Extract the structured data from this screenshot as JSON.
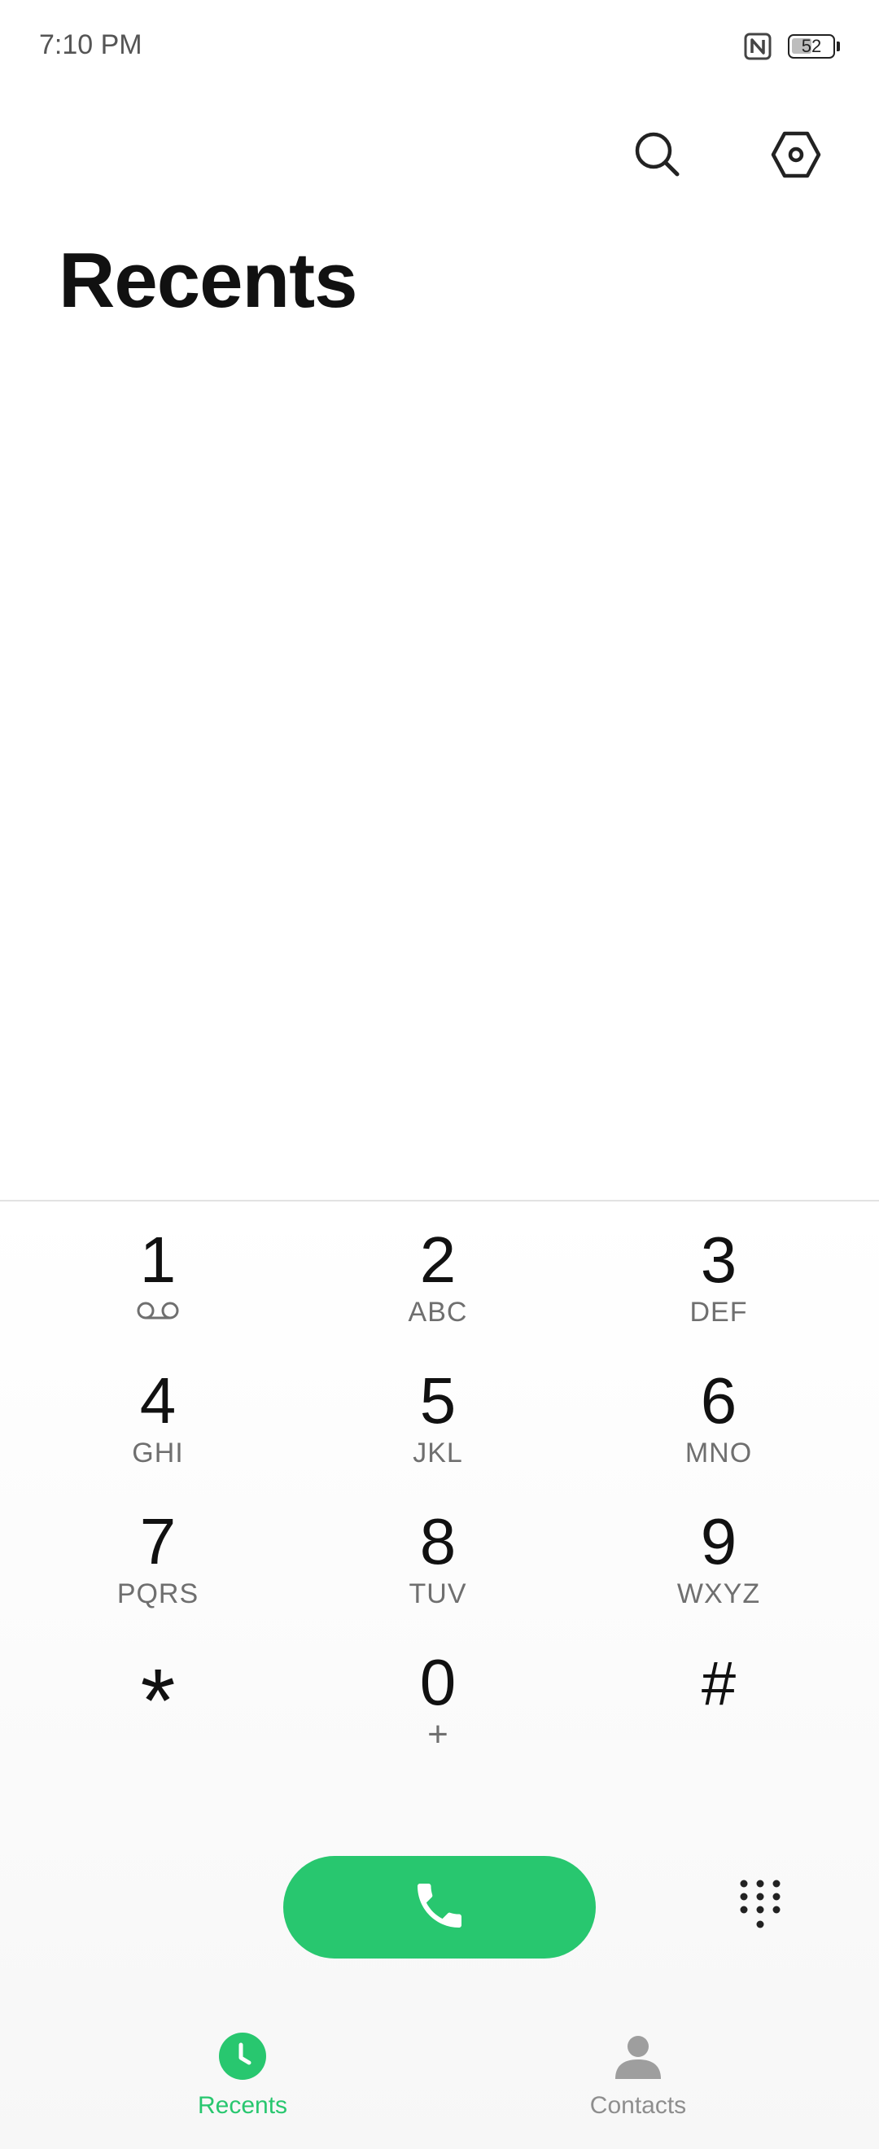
{
  "status_bar": {
    "time": "7:10 PM",
    "battery_level": "52",
    "battery_fraction": 0.52,
    "icons": [
      "nfc-icon",
      "battery-icon"
    ]
  },
  "header": {
    "actions": [
      "search-icon",
      "settings-icon"
    ],
    "title": "Recents"
  },
  "dialpad": {
    "keys": [
      {
        "digit": "1",
        "letters": "",
        "icon": "voicemail-icon"
      },
      {
        "digit": "2",
        "letters": "ABC"
      },
      {
        "digit": "3",
        "letters": "DEF"
      },
      {
        "digit": "4",
        "letters": "GHI"
      },
      {
        "digit": "5",
        "letters": "JKL"
      },
      {
        "digit": "6",
        "letters": "MNO"
      },
      {
        "digit": "7",
        "letters": "PQRS"
      },
      {
        "digit": "8",
        "letters": "TUV"
      },
      {
        "digit": "9",
        "letters": "WXYZ"
      },
      {
        "digit": "*",
        "letters": ""
      },
      {
        "digit": "0",
        "letters": "+"
      },
      {
        "digit": "#",
        "letters": ""
      }
    ],
    "call_icon": "phone-icon",
    "toggle_icon": "dialpad-icon"
  },
  "bottom_nav": {
    "tabs": [
      {
        "label": "Recents",
        "icon": "clock-icon",
        "active": true
      },
      {
        "label": "Contacts",
        "icon": "person-icon",
        "active": false
      }
    ]
  },
  "colors": {
    "accent": "#28c76f",
    "inactive": "#8e8e8e"
  }
}
